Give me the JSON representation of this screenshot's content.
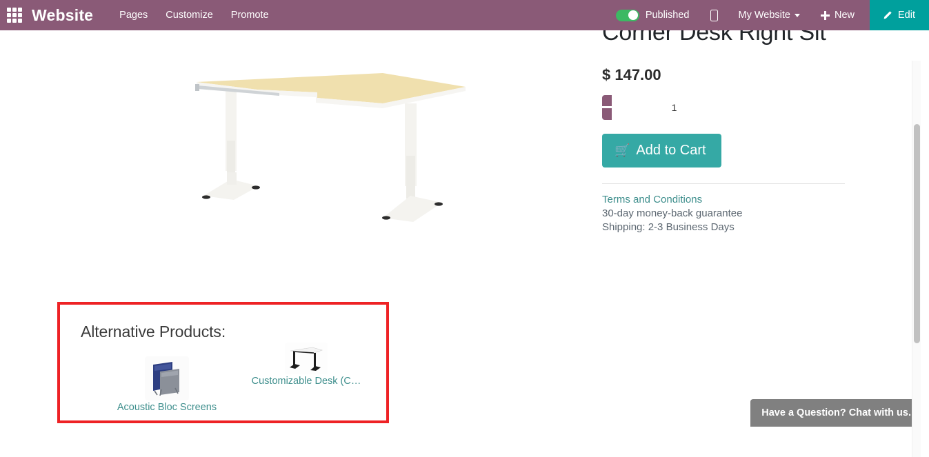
{
  "navbar": {
    "apps_icon": "apps-grid-icon",
    "brand": "Website",
    "menu": [
      {
        "label": "Pages"
      },
      {
        "label": "Customize"
      },
      {
        "label": "Promote"
      }
    ],
    "publish_toggle": {
      "state": "on",
      "label": "Published",
      "color": "#3cb963"
    },
    "mobile_preview_icon": "mobile-phone-icon",
    "website_selector": {
      "label": "My Website",
      "caret": "chevron-down-icon"
    },
    "new_button": {
      "label": "New",
      "icon": "plus-icon"
    },
    "edit_button": {
      "label": "Edit",
      "icon": "pencil-icon",
      "color": "#00a09d"
    },
    "background_color": "#8a5a77"
  },
  "product": {
    "title": "Corner Desk Right Sit",
    "price": "$ 147.00",
    "quantity": "1",
    "quantity_minus_label": "−",
    "quantity_plus_label": "+",
    "add_to_cart_label": "Add to Cart",
    "cart_icon": "shopping-cart-icon",
    "terms_link": "Terms and Conditions",
    "guarantee": "30-day money-back guarantee",
    "shipping": "Shipping: 2-3 Business Days",
    "image_alt": "corner-desk-beige-top-white-legs"
  },
  "alternative_products": {
    "heading": "Alternative Products:",
    "highlight_color": "#ee2225",
    "items": [
      {
        "label": "Acoustic Bloc Screens",
        "thumb": "acoustic-bloc-screens-thumbnail"
      },
      {
        "label": "Customizable Desk (C…",
        "thumb": "customizable-desk-thumbnail"
      }
    ]
  },
  "chat_widget": {
    "text": "Have a Question? Chat with us.",
    "background_color": "#808080"
  }
}
